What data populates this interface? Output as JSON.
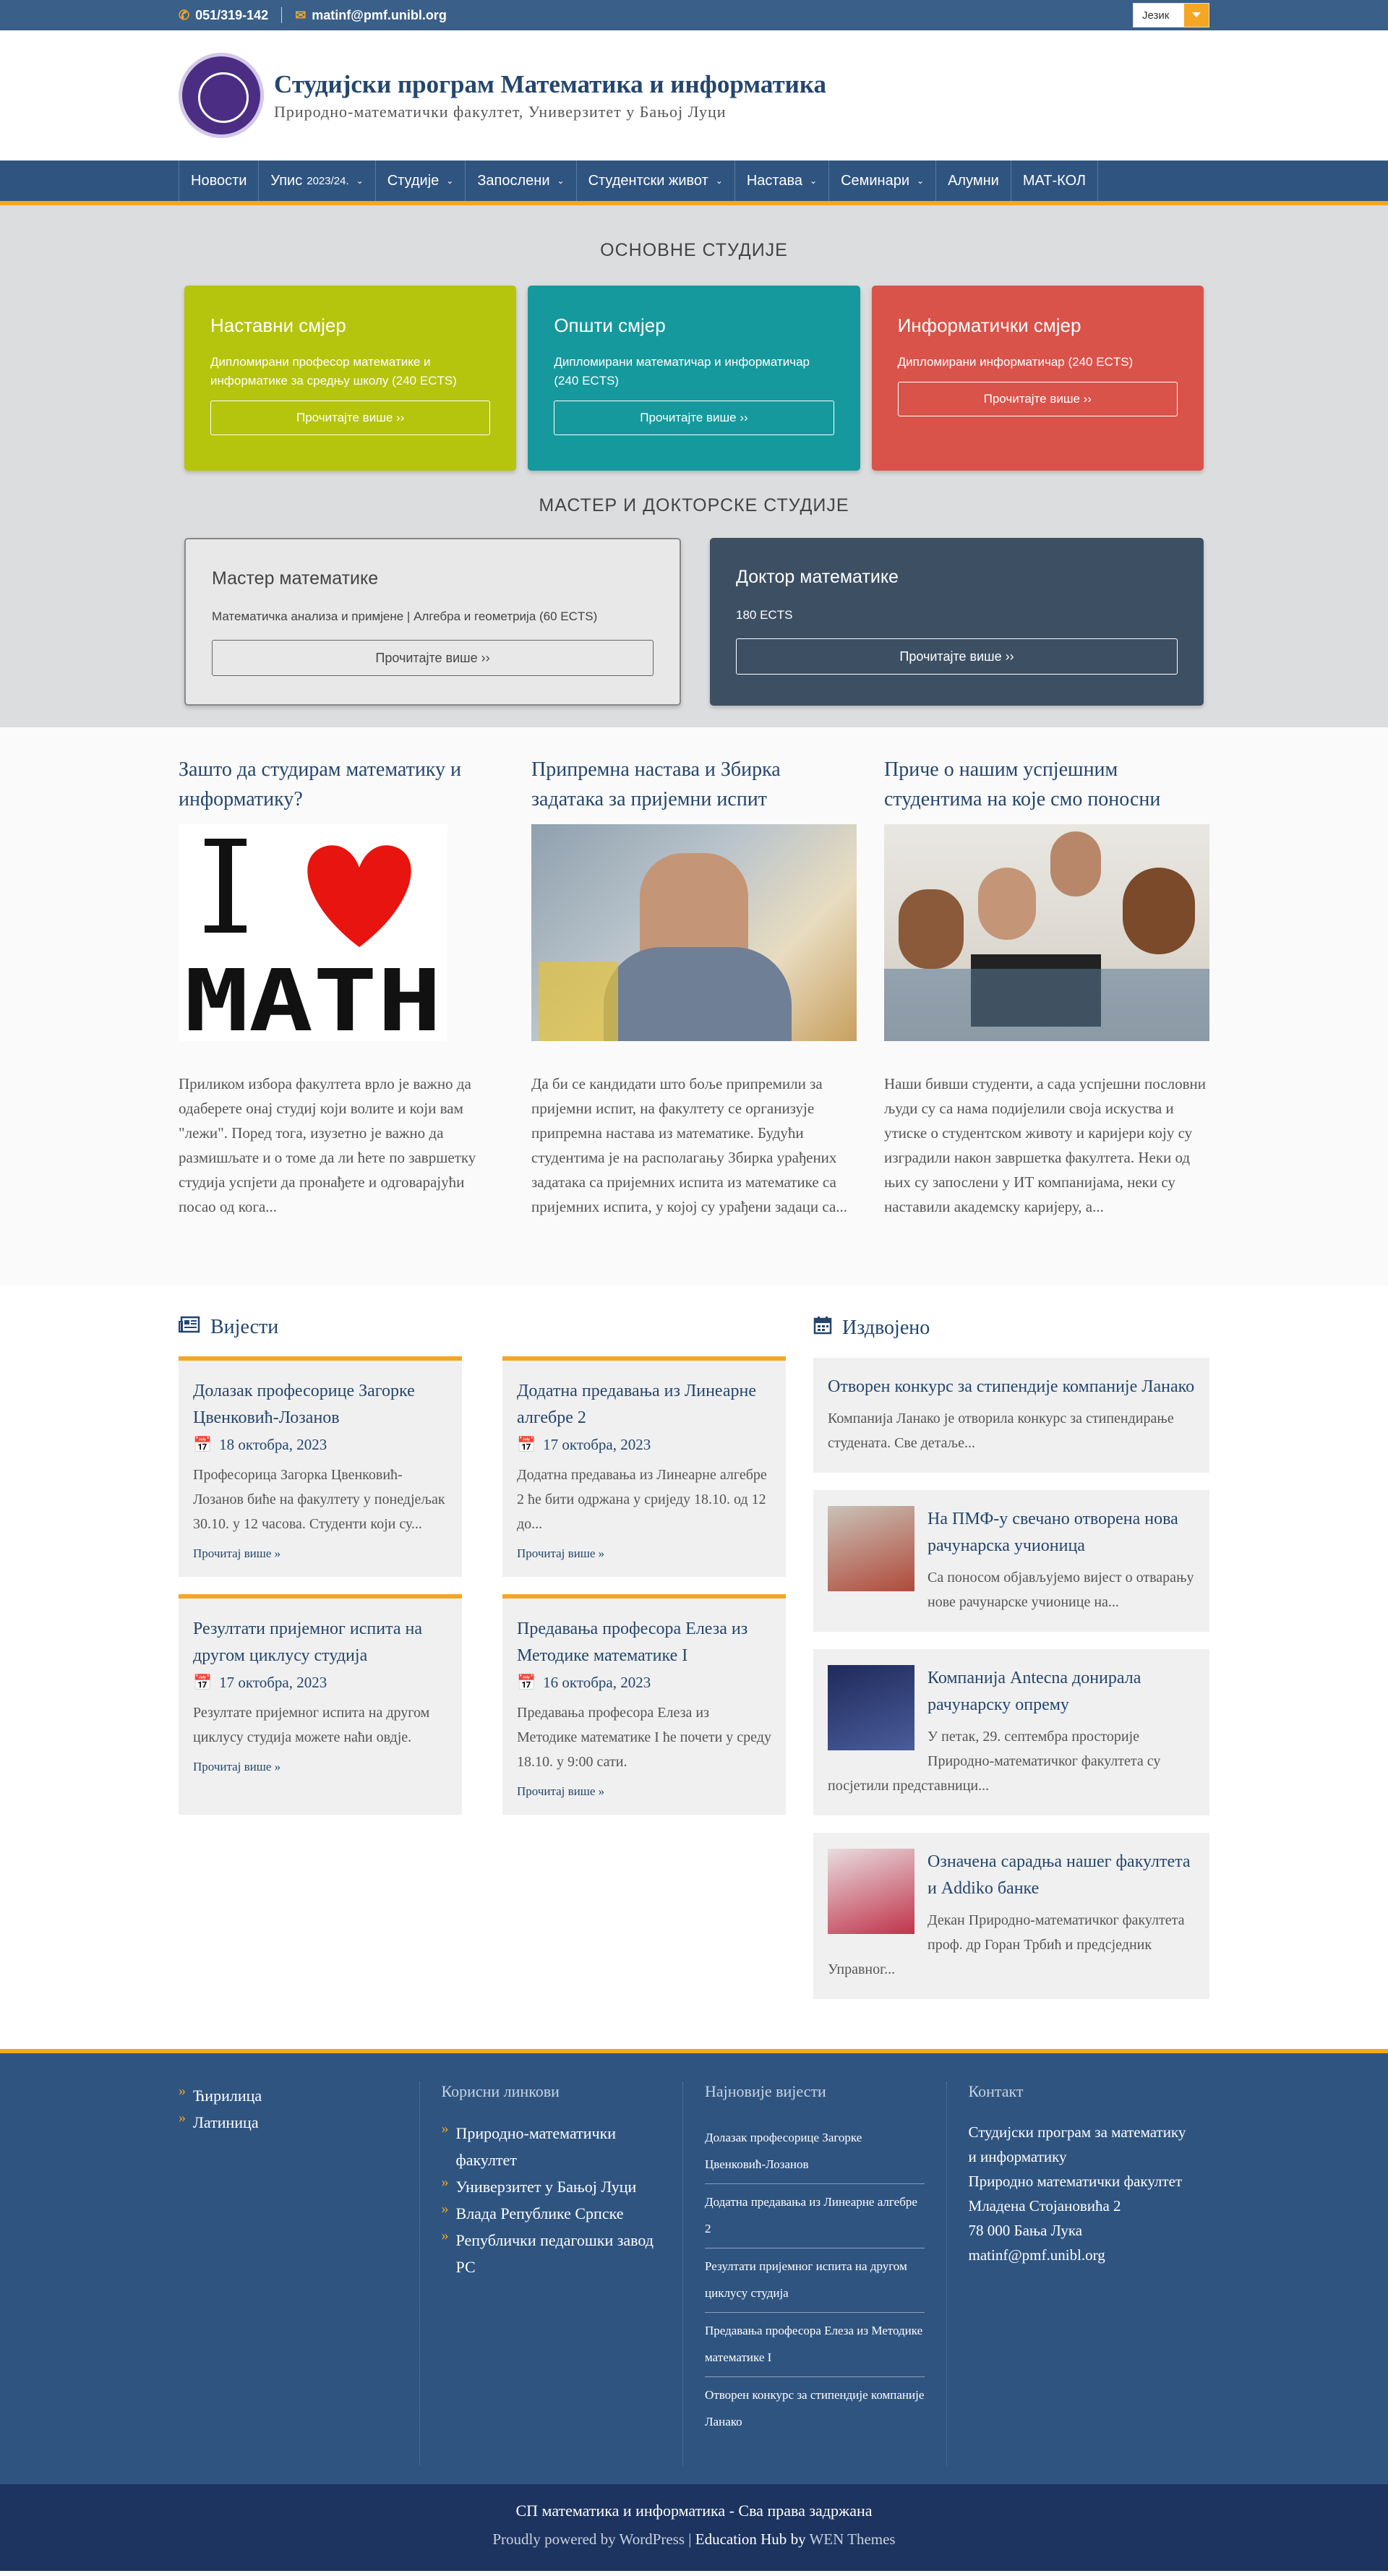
{
  "topbar": {
    "phone": "051/319-142",
    "email": "matinf@pmf.unibl.org",
    "lang_label": "Језик"
  },
  "header": {
    "title": "Студијски програм Математика и информатика",
    "subtitle": "Природно-математички факултет, Универзитет у Бањој Луци"
  },
  "nav": [
    {
      "label": "Новости",
      "sub": "",
      "dropdown": false
    },
    {
      "label": "Упис",
      "sub": "2023/24.",
      "dropdown": true
    },
    {
      "label": "Студије",
      "sub": "",
      "dropdown": true
    },
    {
      "label": "Запослени",
      "sub": "",
      "dropdown": true
    },
    {
      "label": "Студентски живот",
      "sub": "",
      "dropdown": true
    },
    {
      "label": "Настава",
      "sub": "",
      "dropdown": true
    },
    {
      "label": "Семинари",
      "sub": "",
      "dropdown": true
    },
    {
      "label": "Алумни",
      "sub": "",
      "dropdown": false
    },
    {
      "label": "МАТ-КОЛ",
      "sub": "",
      "dropdown": false
    }
  ],
  "studies": {
    "basic_heading": "ОСНОВНЕ СТУДИЈЕ",
    "basic": [
      {
        "title": "Наставни смјер",
        "text": "Дипломирани професор математике и информатике за средњу школу (240 ECTS)",
        "button": "Прочитајте више ››",
        "color": "#b5c40d"
      },
      {
        "title": "Општи смјер",
        "text": "Дипломирани математичар и информатичар (240 ECTS)",
        "button": "Прочитајте више ››",
        "color": "#16999d"
      },
      {
        "title": "Информатички смјер",
        "text": "Дипломирани информатичар (240 ECTS)",
        "button": "Прочитајте више ››",
        "color": "#d9534a"
      }
    ],
    "master_heading": "МАСТЕР И ДОКТОРСКЕ СТУДИЈЕ",
    "advanced": [
      {
        "title": "Мастер математике",
        "text": "Математичка анализа и примјене | Алгебра и геометрија (60 ECTS)",
        "button": "Прочитајте више ››"
      },
      {
        "title": "Доктор математике",
        "text": "180 ECTS",
        "button": "Прочитајте више ››"
      }
    ]
  },
  "features": [
    {
      "title": "Зашто да студирам математику и информатику?",
      "image": "i-love-math-image",
      "text": "Приликом избора факултета врло је важно да одаберете онај студиј који волите и који вам \"лежи\". Поред тога, изузетно је важно да размишљате и о томе да ли ћете по завршетку студија успјети да пронађете и одговарајући посао од кога..."
    },
    {
      "title": "Припремна настава и Збирка задатака за пријемни испит",
      "image": "student-studying-photo",
      "text": "Да би се кандидати што боље припремили за пријемни испит, на факултету се организује припремна настава из математике. Будући студентима је на располагању Збирка урађених задатака са пријемних испита из математике са пријемних испита, у којој су урађени задаци са..."
    },
    {
      "title": "Приче о нашим успјешним студентима на које смо поносни",
      "image": "students-group-photo",
      "text": "Наши бивши студенти, а сада успјешни пословни људи су са нама подијелили своја искуства и утиске о студентском животу и каријери коју су изградили након завршетка факултета. Неки од њих су запослени у ИТ компанијама, неки су наставили академску каријеру, а..."
    }
  ],
  "news": {
    "heading": "Вијести",
    "items": [
      {
        "title": "Долазак професорице Загорке Цвенковић-Лозанов",
        "date": "18 октобра, 2023",
        "text": "Професорица Загорка Цвенковић-Лозанов биће на факултету у понедјељак 30.10. у 12 часова. Студенти који су...",
        "more": "Прочитај више"
      },
      {
        "title": "Додатна предавања из Линеарне алгебре 2",
        "date": "17 октобра, 2023",
        "text": "Додатна предавања из Линеарне алгебре 2 ће бити одржана у сриједу 18.10. од 12 до...",
        "more": "Прочитај више"
      },
      {
        "title": "Резултати пријемног испита на другом циклусу студија",
        "date": "17 октобра, 2023",
        "text": "Резултате пријемног испита на другом циклусу студија можете наћи овдје.",
        "more": "Прочитај више"
      },
      {
        "title": "Предавања професора Елеза из Методике математике I",
        "date": "16 октобра, 2023",
        "text": "Предавања професора Елеза из Методике математике I ће почети у среду 18.10. у 9:00 сати.",
        "more": "Прочитај више"
      }
    ]
  },
  "featured": {
    "heading": "Издвојено",
    "items": [
      {
        "title": "Отворен конкурс за стипендије компаније Ланако",
        "text": "Компанија Ланако је отворила конкурс за стипендирање студената. Све детаље...",
        "thumb": false
      },
      {
        "title": "На ПМФ-у свечано отворена нова рачунарска учионица",
        "text": "Са поносом објављујемо вијест о отварању нове рачунарске учионице на...",
        "thumb": true,
        "thumb_colors": [
          "#c9c2b8",
          "#b04a3a"
        ]
      },
      {
        "title": "Компанија Antecna донирала рачунарску опрему",
        "text": "У петак, 29. септембра просторије Природно-математичког факултета су посјетили представници...",
        "thumb": true,
        "thumb_colors": [
          "#1e2a5a",
          "#4a5c9a"
        ]
      },
      {
        "title": "Означена сарадња нашег факултета и Addiko банке",
        "text": "Декан Природно-математичког факултета проф. др Горан Трбић и предсједник Управног...",
        "thumb": true,
        "thumb_colors": [
          "#e8dde0",
          "#c0334a"
        ]
      }
    ]
  },
  "footer": {
    "languages": [
      "Ћирилица",
      "Латиница"
    ],
    "links_heading": "Корисни линкови",
    "links": [
      "Природно-математички факултет",
      "Универзитет у Бањој Луци",
      "Влада Републике Српске",
      "Републички педагошки завод РС"
    ],
    "latest_heading": "Најновије вијести",
    "latest": [
      "Долазак професорице Загорке Цвенковић-Лозанов",
      "Додатна предавања из Линеарне алгебре 2",
      "Резултати пријемног испита на другом циклусу студија",
      "Предавања професора Елеза из Методике математике I",
      "Отворен конкурс за стипендије компаније Ланако"
    ],
    "contact_heading": "Контакт",
    "contact": [
      "Студијски програм за математику и информатику",
      "Природно математички факултет",
      "Младена Стојановића 2",
      "78 000 Бања Лука",
      "matinf@pmf.unibl.org"
    ]
  },
  "bottom": {
    "copyright": "СП математика и информатика - Сва права задржана",
    "powered": "Proudly powered by WordPress",
    "theme_name": "Education Hub",
    "theme_by": "by",
    "theme_author": "WEN Themes"
  },
  "colors": {
    "accent": "#f5a623",
    "brand": "#2f5480",
    "dark": "#3d4f63"
  }
}
